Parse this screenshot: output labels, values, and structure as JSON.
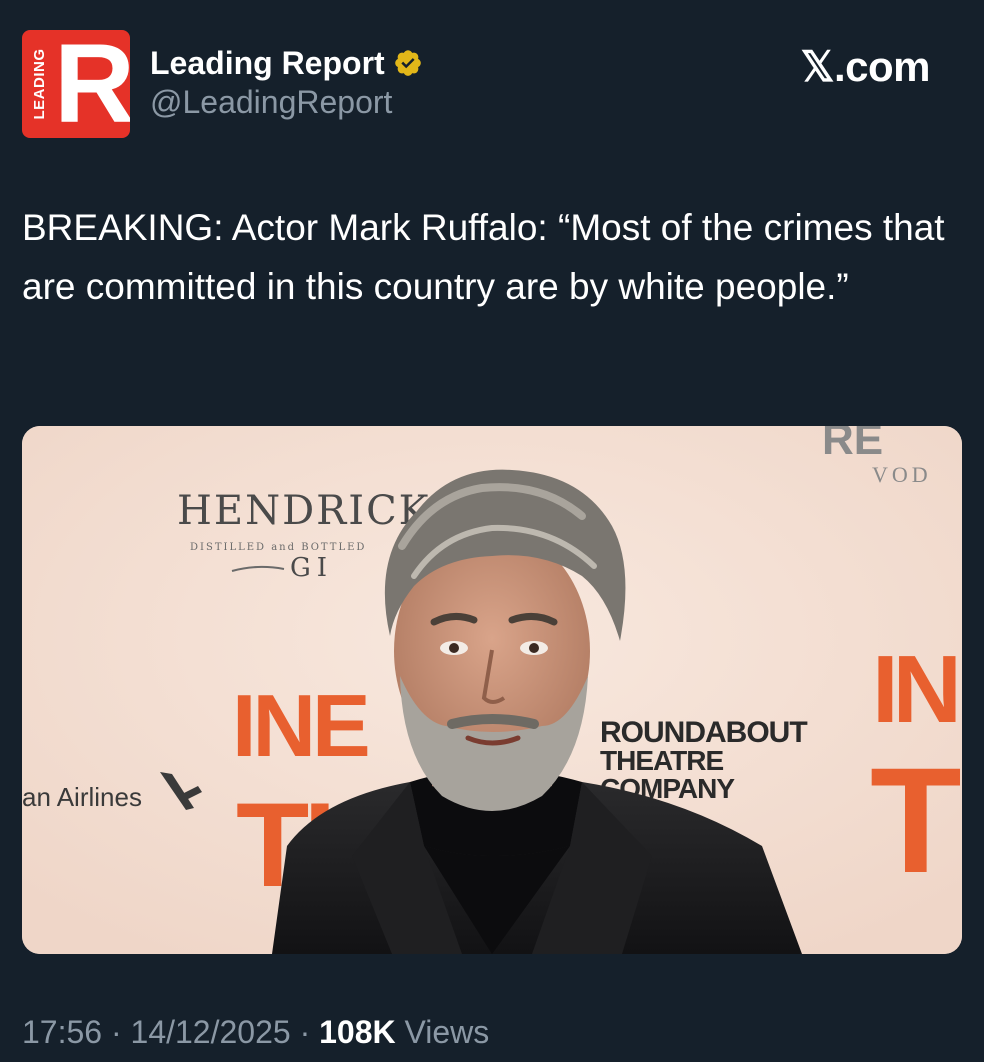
{
  "account": {
    "logo_side_text": "LEADING",
    "logo_letter": "R",
    "display_name": "Leading Report",
    "handle": "@LeadingReport",
    "verified_icon": "gold-verified-badge"
  },
  "brand": "𝕏.com",
  "tweet": {
    "text": "BREAKING: Actor Mark Ruffalo: “Most of the crimes that are committed in this country are by white people.”"
  },
  "photo": {
    "backdrop_texts": {
      "hendricks": "HENDRICK'S",
      "distilled": "DISTILLED and BOTTLED",
      "gin": "GI",
      "red_top": "RE",
      "vod": "VOD",
      "airlines": "an Airlines",
      "roundabout_1": "ROUNDABOUT",
      "roundabout_2": "THEATRE",
      "roundabout_3": "COMPANY",
      "orange_1": "INE",
      "orange_2": "TH",
      "orange_right_1": "IN",
      "orange_right_2": "T"
    }
  },
  "meta": {
    "time": "17:56",
    "sep1": " · ",
    "date": "14/12/2025",
    "sep2": " · ",
    "views_count": "108K",
    "views_label": " Views"
  },
  "colors": {
    "background": "#15202b",
    "logo_red": "#e53228",
    "muted_text": "#8b98a5",
    "verified_gold": "#e2b719"
  }
}
